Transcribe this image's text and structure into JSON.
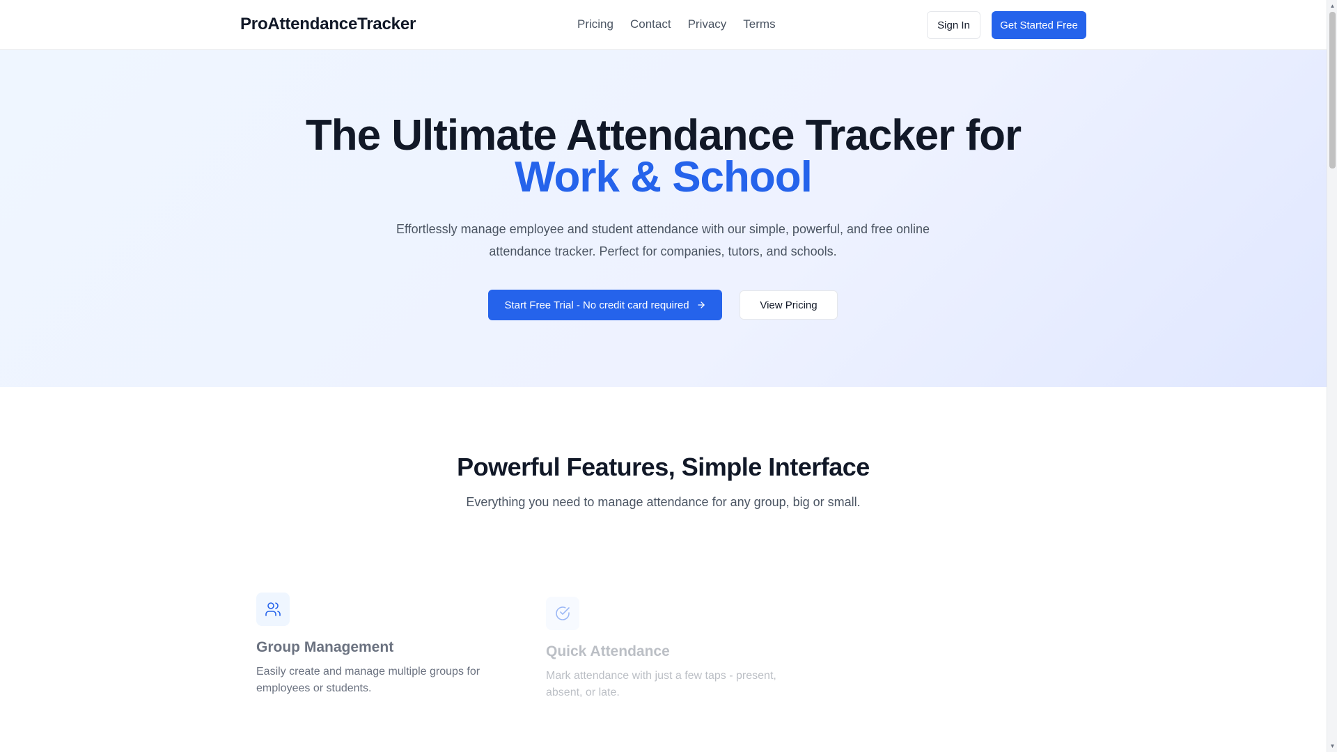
{
  "header": {
    "brand": "ProAttendanceTracker",
    "nav": [
      "Pricing",
      "Contact",
      "Privacy",
      "Terms"
    ],
    "signin_label": "Sign In",
    "get_started_label": "Get Started Free"
  },
  "hero": {
    "title_line1": "The Ultimate Attendance Tracker for",
    "title_line2": "Work & School",
    "subtitle": "Effortlessly manage employee and student attendance with our simple, powerful, and free online attendance tracker. Perfect for companies, tutors, and schools.",
    "primary_cta": "Start Free Trial - No credit card required",
    "secondary_cta": "View Pricing"
  },
  "features": {
    "title": "Powerful Features, Simple Interface",
    "subtitle": "Everything you need to manage attendance for any group, big or small.",
    "items": [
      {
        "icon": "users-icon",
        "title": "Group Management",
        "description": "Easily create and manage multiple groups for employees or students."
      },
      {
        "icon": "check-circle-icon",
        "title": "Quick Attendance",
        "description": "Mark attendance with just a few taps - present, absent, or late."
      }
    ]
  },
  "colors": {
    "accent": "#2563eb",
    "heading": "#111827",
    "body_text": "#4b5563",
    "hero_bg": "#eef2ff"
  }
}
